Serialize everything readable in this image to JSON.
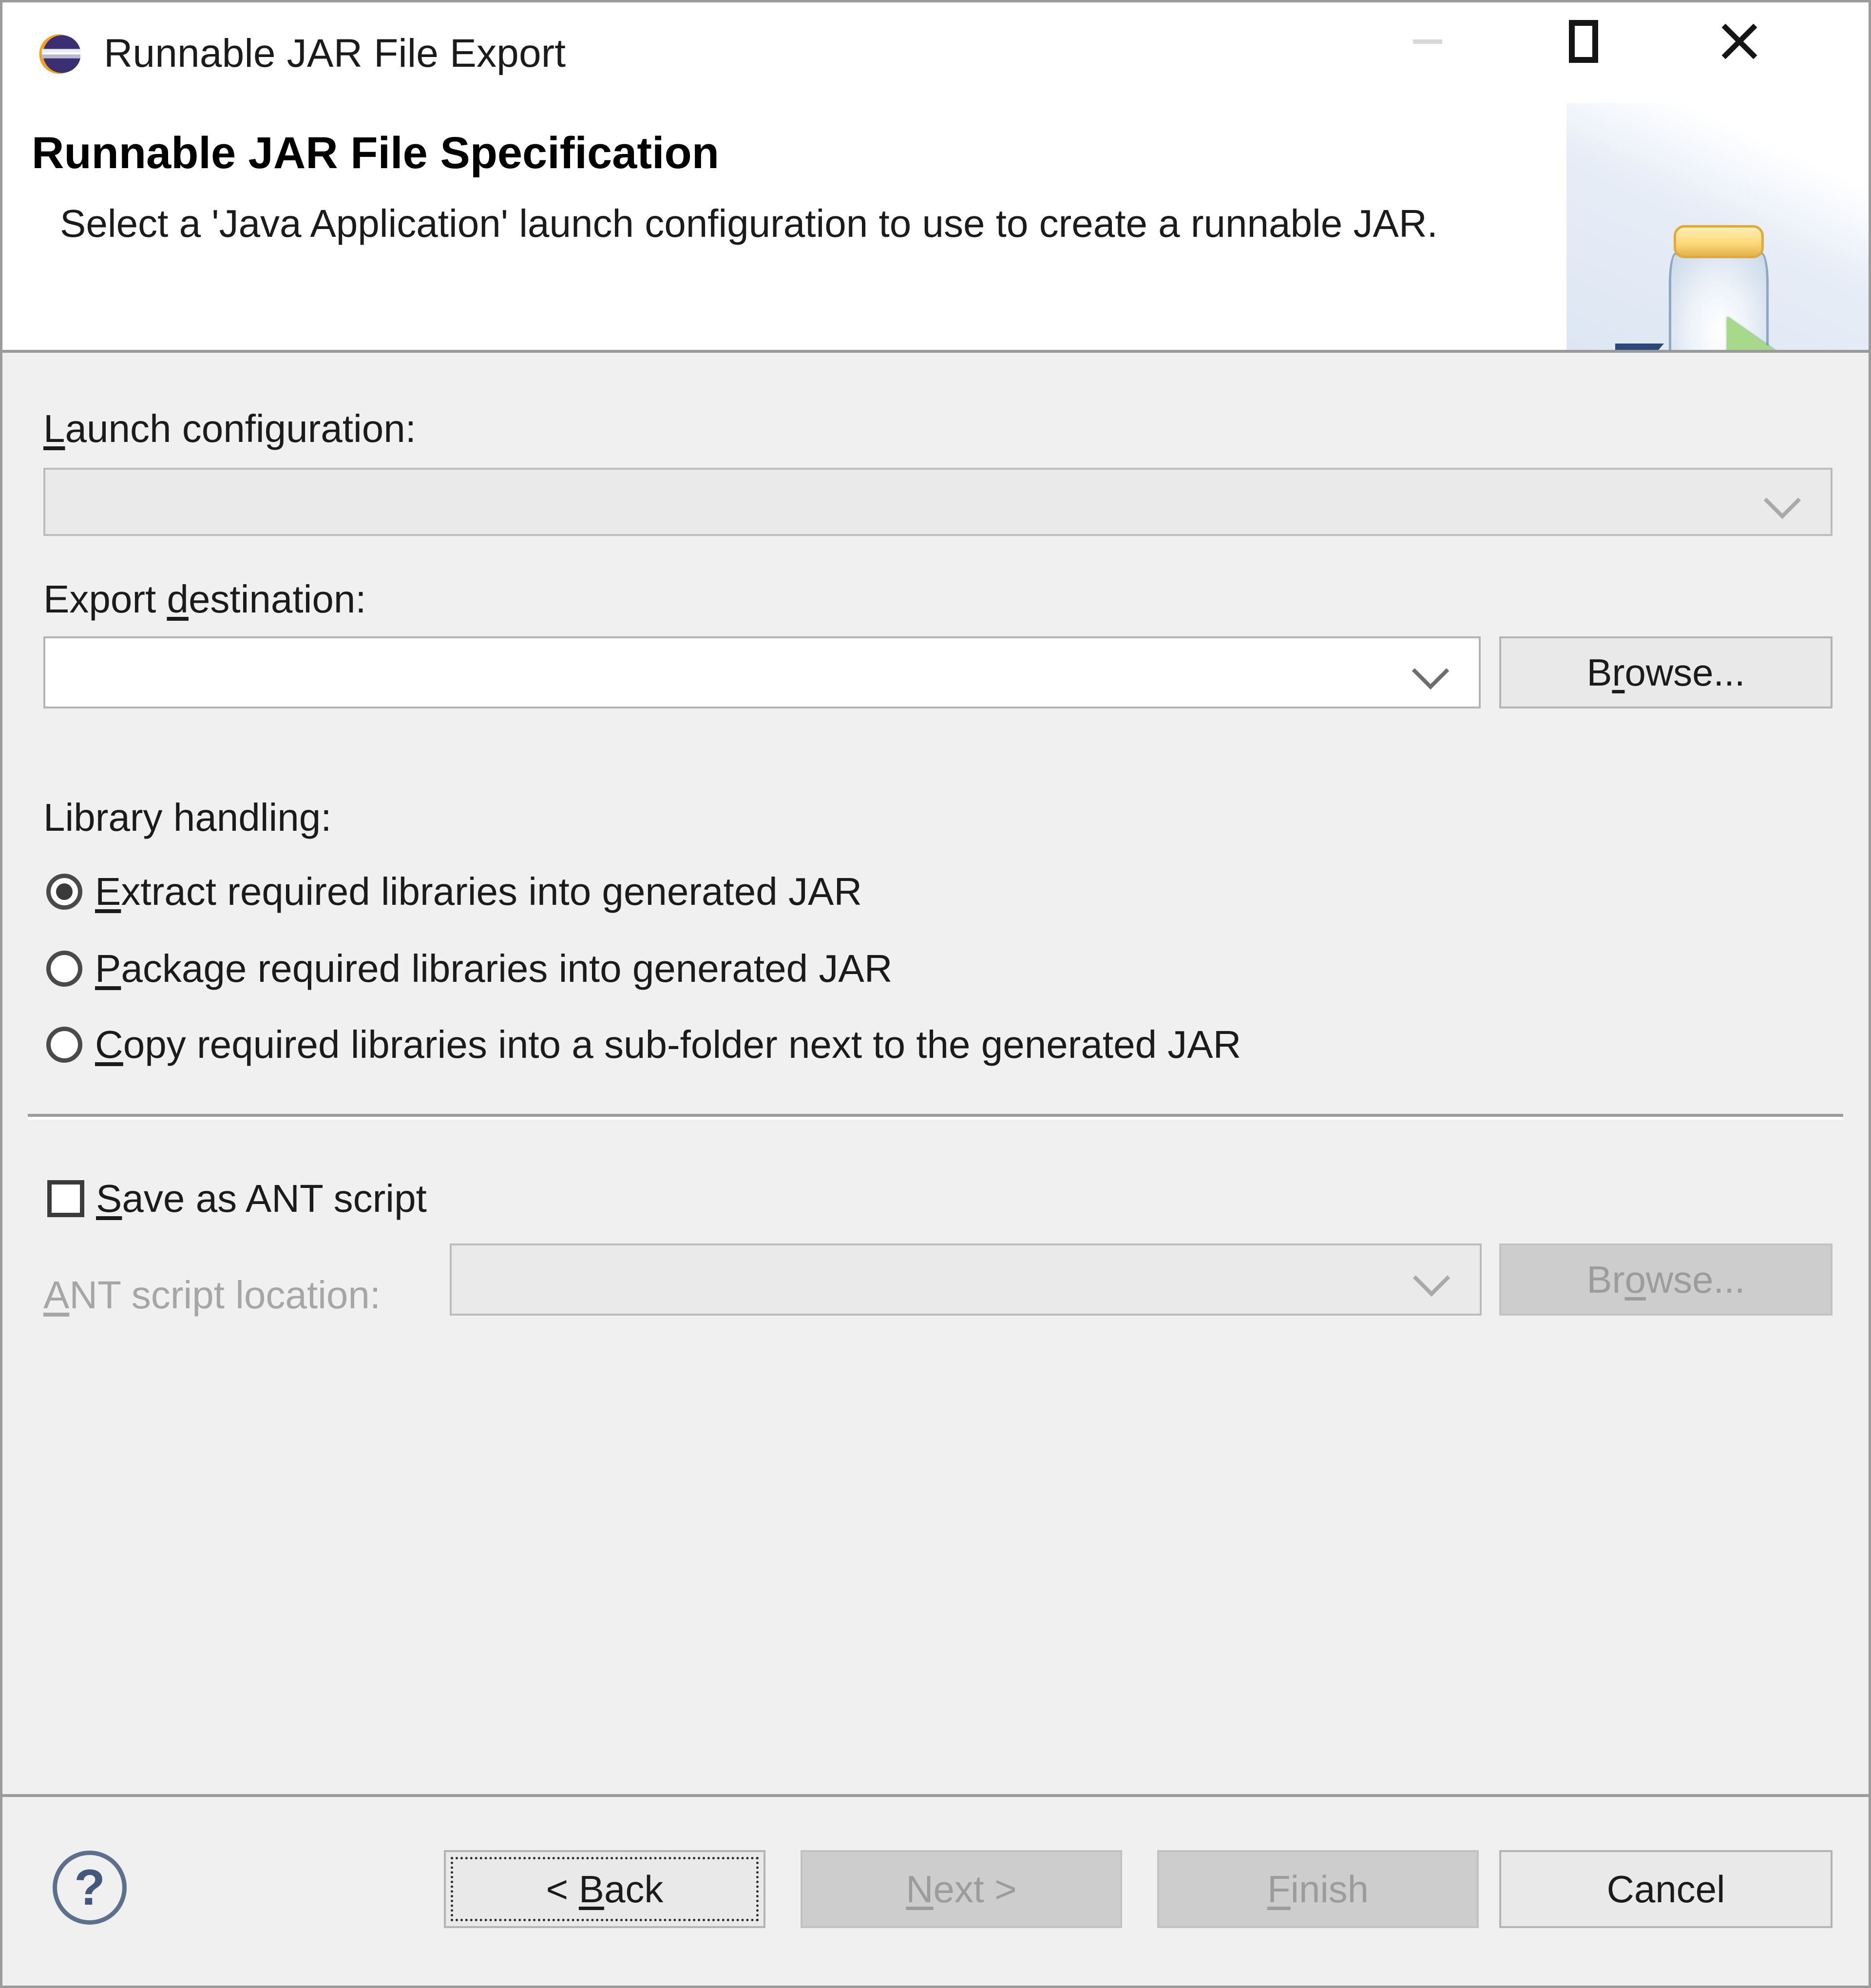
{
  "window": {
    "title": "Runnable JAR File Export",
    "app_icon": "eclipse-icon",
    "controls": {
      "minimize": "minimize-icon",
      "maximize": "maximize-icon",
      "close": "close-icon"
    }
  },
  "banner": {
    "title": "Runnable JAR File Specification",
    "description": "Select a 'Java Application' launch configuration to use to create a runnable JAR.",
    "icon": "runnable-jar-icon"
  },
  "form": {
    "launch_configuration": {
      "label": "Launch configuration:",
      "mnemonic": "L",
      "value": "",
      "placeholder": "",
      "enabled": false
    },
    "export_destination": {
      "label": "Export destination:",
      "mnemonic": "d",
      "value": "",
      "placeholder": "",
      "browse_label": "Browse...",
      "browse_mnemonic": "r",
      "enabled": true
    },
    "library_handling": {
      "label": "Library handling:",
      "options": [
        {
          "label": "Extract required libraries into generated JAR",
          "mnemonic": "E",
          "selected": true
        },
        {
          "label": "Package required libraries into generated JAR",
          "mnemonic": "P",
          "selected": false
        },
        {
          "label": "Copy required libraries into a sub-folder next to the generated JAR",
          "mnemonic": "C",
          "selected": false
        }
      ]
    },
    "save_as_ant": {
      "label": "Save as ANT script",
      "mnemonic": "S",
      "checked": false
    },
    "ant_script_location": {
      "label": "ANT script location:",
      "mnemonic": "A",
      "value": "",
      "placeholder": "",
      "browse_label": "Browse...",
      "browse_mnemonic": "o",
      "enabled": false
    }
  },
  "footer": {
    "help": "?",
    "buttons": [
      {
        "label": "< Back",
        "mnemonic": "B",
        "enabled": true,
        "focused": true
      },
      {
        "label": "Next >",
        "mnemonic": "N",
        "enabled": false,
        "focused": false
      },
      {
        "label": "Finish",
        "mnemonic": "F",
        "enabled": false,
        "focused": false
      },
      {
        "label": "Cancel",
        "mnemonic": "",
        "enabled": true,
        "focused": false
      }
    ]
  },
  "colors": {
    "dialog_bg": "#f0f0f0",
    "banner_bg": "#ffffff",
    "border": "#9b9b9b",
    "text": "#1b1b1b",
    "disabled_text": "#a6a6a6",
    "accent_eclipse_purple": "#3b2f72",
    "accent_eclipse_orange": "#f5a020",
    "jar_cap": "#fbd97a",
    "jar_glass": "#c9d8e9",
    "arrow_green": "#a6d98a",
    "arrow_blue": "#2c4878"
  }
}
